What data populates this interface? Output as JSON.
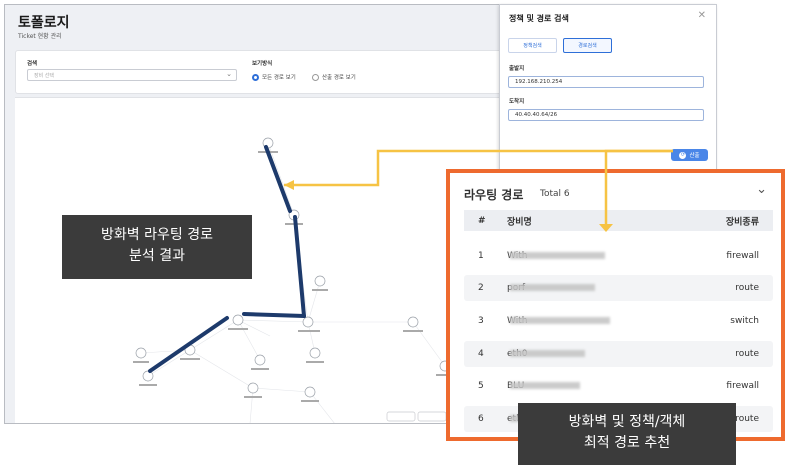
{
  "header": {
    "title": "토폴로지",
    "subtitle": "Ticket 현황 관리"
  },
  "filter": {
    "search_label": "검색",
    "search_placeholder": "장비 선택",
    "view_label": "보기방식",
    "view_options": [
      {
        "label": "모든 경로 보기",
        "selected": true
      },
      {
        "label": "산출 경로 보기",
        "selected": false
      }
    ]
  },
  "policy_panel": {
    "title": "정책 및 경로 검색",
    "tabs": [
      {
        "label": "정책검색",
        "active": false
      },
      {
        "label": "경로검색",
        "active": true
      }
    ],
    "source_label": "출발지",
    "source_value": "192.168.210.254",
    "dest_label": "도착지",
    "dest_value": "40.40.40.64/26",
    "calc_button": "산출"
  },
  "routing_panel": {
    "title": "라우팅 경로",
    "total": "Total 6",
    "columns": {
      "no": "#",
      "name": "장비명",
      "type": "장비종류"
    },
    "rows": [
      {
        "no": "1",
        "name": "With",
        "type": "firewall"
      },
      {
        "no": "2",
        "name": "porf",
        "type": "route"
      },
      {
        "no": "3",
        "name": "With",
        "type": "switch"
      },
      {
        "no": "4",
        "name": "eth0",
        "type": "route"
      },
      {
        "no": "5",
        "name": "BLU",
        "type": "firewall"
      },
      {
        "no": "6",
        "name": "eth2",
        "type": "route"
      }
    ]
  },
  "callouts": {
    "left": {
      "line1": "방화벽 라우팅 경로",
      "line2": "분석 결과"
    },
    "bottom": {
      "line1": "방화벽 및 정책/객체",
      "line2": "최적 경로 추천"
    }
  },
  "colors": {
    "accent": "#4a86e8",
    "highlight_border": "#ee6a2e",
    "connector": "#f6c344",
    "path": "#1d3a6b"
  }
}
